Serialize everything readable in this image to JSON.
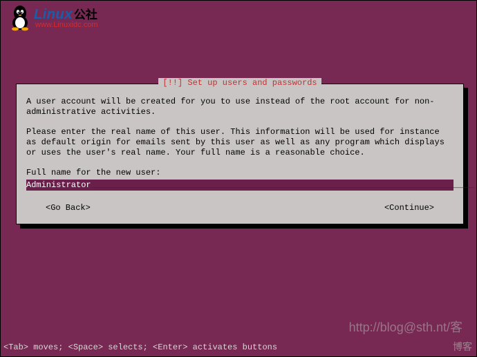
{
  "logo": {
    "main": "Linux",
    "suffix_cn": "公社",
    "url": "www.Linuxidc.com"
  },
  "dialog": {
    "title": "[!!] Set up users and passwords",
    "para1": "A user account will be created for you to use instead of the root account for non-administrative activities.",
    "para2": "Please enter the real name of this user. This information will be used for instance as default origin for emails sent by this user as well as any program which displays or uses the user's real name. Your full name is a reasonable choice.",
    "prompt": "Full name for the new user:",
    "input_value": "Administrator",
    "go_back": "<Go Back>",
    "continue": "<Continue>"
  },
  "help": "<Tab> moves; <Space> selects; <Enter> activates buttons",
  "watermark1": "http://blog@sth.nt/客",
  "watermark2": "博客"
}
